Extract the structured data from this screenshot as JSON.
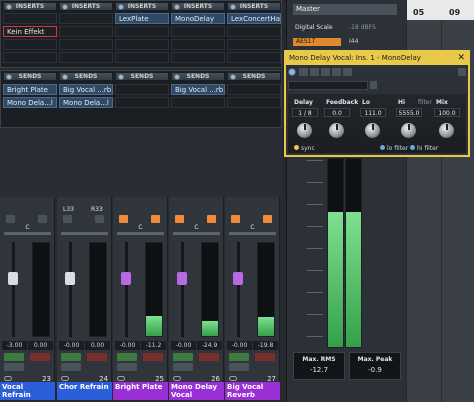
{
  "inserts": {
    "header": "INSERTS",
    "columns": [
      {
        "slots": [
          "",
          "Kein Effekt",
          "",
          ""
        ]
      },
      {
        "slots": [
          "",
          "",
          "",
          ""
        ]
      },
      {
        "slots": [
          "LexPlate",
          "",
          "",
          ""
        ]
      },
      {
        "slots": [
          "MonoDelay",
          "",
          "",
          ""
        ]
      },
      {
        "slots": [
          "LexConcertHall",
          "",
          "",
          ""
        ]
      }
    ]
  },
  "sends": {
    "header": "SENDS",
    "columns": [
      {
        "slots": [
          "Bright Plate",
          "Mono Dela...l"
        ]
      },
      {
        "slots": [
          "Big Vocal ...rb",
          "Mono Dela...l"
        ]
      },
      {
        "slots": [
          "",
          ""
        ]
      },
      {
        "slots": [
          "Big Vocal ...rb",
          ""
        ]
      },
      {
        "slots": [
          "",
          ""
        ]
      }
    ]
  },
  "master": {
    "name": "Master",
    "digital_scale_label": "Digital Scale",
    "digital_scale_value": "-18 dBFS",
    "channel_label": "AES17",
    "channel_value": "I44",
    "timeline_05": "05",
    "timeline_09": "09",
    "max_rms_label": "Max. RMS",
    "max_rms_value": "-12.7",
    "max_peak_label": "Max. Peak",
    "max_peak_value": "-0.9",
    "meter_levels": [
      0.72,
      0.72
    ]
  },
  "plugin": {
    "title": "Mono Delay Vocal: Ins. 1 - MonoDelay",
    "params": [
      {
        "label": "Delay",
        "value": "1 / 8"
      },
      {
        "label": "Feedback",
        "value": "0.0"
      },
      {
        "label": "Lo",
        "value": "111.0"
      },
      {
        "label": "Hi",
        "value": "5555.0"
      },
      {
        "label": "Mix",
        "value": "100.0"
      }
    ],
    "filter_label": "filter",
    "sync_label": "sync",
    "lo_filter_label": "lo filter",
    "hi_filter_label": "hi filter"
  },
  "channels": [
    {
      "pan": "C",
      "volume": "-3.00",
      "meter": "0.00",
      "name": "Vocal Refrain",
      "number": "23",
      "color": "#2b5fd9",
      "fader_color": "#d9dde1",
      "fader_level": 0.62,
      "meter_level": 0.0
    },
    {
      "pan_l": "L33",
      "pan_r": "R33",
      "volume": "-0.00",
      "meter": "0.00",
      "name": "Chor Refrain",
      "number": "24",
      "color": "#2b5fd9",
      "fader_color": "#d9dde1",
      "fader_level": 0.62,
      "meter_level": 0.0
    },
    {
      "pan": "C",
      "volume": "-0.00",
      "meter": "-11.2",
      "name": "Bright Plate",
      "number": "25",
      "color": "#9b2fd6",
      "fader_color": "#b66be0",
      "fader_level": 0.62,
      "meter_level": 0.22
    },
    {
      "pan": "C",
      "volume": "-0.00",
      "meter": "-24.9",
      "name": "Mono Delay Vocal",
      "number": "26",
      "color": "#9b2fd6",
      "fader_color": "#b66be0",
      "fader_level": 0.62,
      "meter_level": 0.16
    },
    {
      "pan": "C",
      "volume": "-0.00",
      "meter": "-19.8",
      "name": "Big Vocal Reverb",
      "number": "27",
      "color": "#9b2fd6",
      "fader_color": "#b66be0",
      "fader_level": 0.62,
      "meter_level": 0.2
    }
  ],
  "colors": {
    "accent": "#e8c94a",
    "plugin_active": "#2f4a66",
    "send_active": "#f08a3c"
  },
  "icons": [
    "power-icon",
    "link-icon",
    "read-icon",
    "write-icon",
    "edit-icon",
    "sync-icon"
  ]
}
